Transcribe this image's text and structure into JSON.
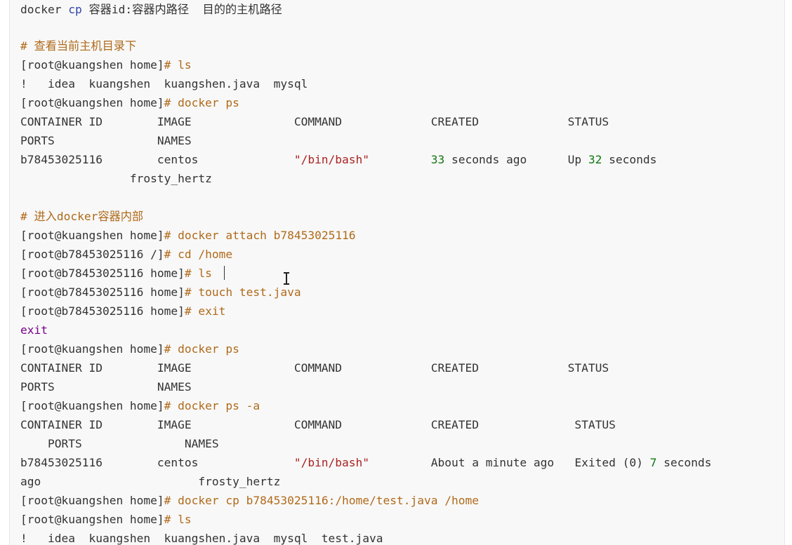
{
  "lines": {
    "l0": {
      "a": "docker ",
      "b": "cp",
      "c": " 容器id:容器内路径  目的的主机路径"
    },
    "l2": {
      "a": "# 查看当前主机目录下"
    },
    "l3": {
      "a": "[root@kuangshen home]",
      "b": "# ls"
    },
    "l4": {
      "a": "!   idea  kuangshen  kuangshen.java  mysql"
    },
    "l5": {
      "a": "[root@kuangshen home]",
      "b": "# docker ps"
    },
    "l6": {
      "a": "CONTAINER ID        IMAGE               COMMAND             CREATED             STATUS"
    },
    "l7": {
      "a": "PORTS               NAMES"
    },
    "l8": {
      "a": "b78453025116        centos              ",
      "b": "\"/bin/bash\"",
      "c": "         ",
      "d": "33",
      "e": " seconds ago      Up ",
      "f": "32",
      "g": " seconds"
    },
    "l9": {
      "a": "                frosty_hertz"
    },
    "l11": {
      "a": "# 进入docker容器内部"
    },
    "l12": {
      "a": "[root@kuangshen home]",
      "b": "# docker attach b78453025116"
    },
    "l13": {
      "a": "[root@b78453025116 /]",
      "b": "# cd /home"
    },
    "l14": {
      "a": "[root@b78453025116 home]",
      "b": "# ls"
    },
    "l15": {
      "a": "[root@b78453025116 home]",
      "b": "# touch test.java"
    },
    "l16": {
      "a": "[root@b78453025116 home]",
      "b": "# exit"
    },
    "l17": {
      "a": "exit"
    },
    "l18": {
      "a": "[root@kuangshen home]",
      "b": "# docker ps"
    },
    "l19": {
      "a": "CONTAINER ID        IMAGE               COMMAND             CREATED             STATUS"
    },
    "l20": {
      "a": "PORTS               NAMES"
    },
    "l21": {
      "a": "[root@kuangshen home]",
      "b": "# docker ps -a"
    },
    "l22": {
      "a": "CONTAINER ID        IMAGE               COMMAND             CREATED              STATUS"
    },
    "l23": {
      "a": "    PORTS               NAMES"
    },
    "l24": {
      "a": "b78453025116        centos              ",
      "b": "\"/bin/bash\"",
      "c": "         About a minute ago   Exited (0) ",
      "d": "7",
      "e": " seconds"
    },
    "l25": {
      "a": "ago                       frosty_hertz"
    },
    "l26": {
      "a": "[root@kuangshen home]",
      "b": "# docker cp b78453025116:/home/test.java /home"
    },
    "l27": {
      "a": "[root@kuangshen home]",
      "b": "# ls"
    },
    "l28": {
      "a": "!   idea  kuangshen  kuangshen.java  mysql  test.java"
    }
  },
  "colors": {
    "keyword": "#3344aa",
    "comment": "#b06a1a",
    "string": "#aa2222",
    "number": "#117711",
    "exit": "#770088"
  }
}
